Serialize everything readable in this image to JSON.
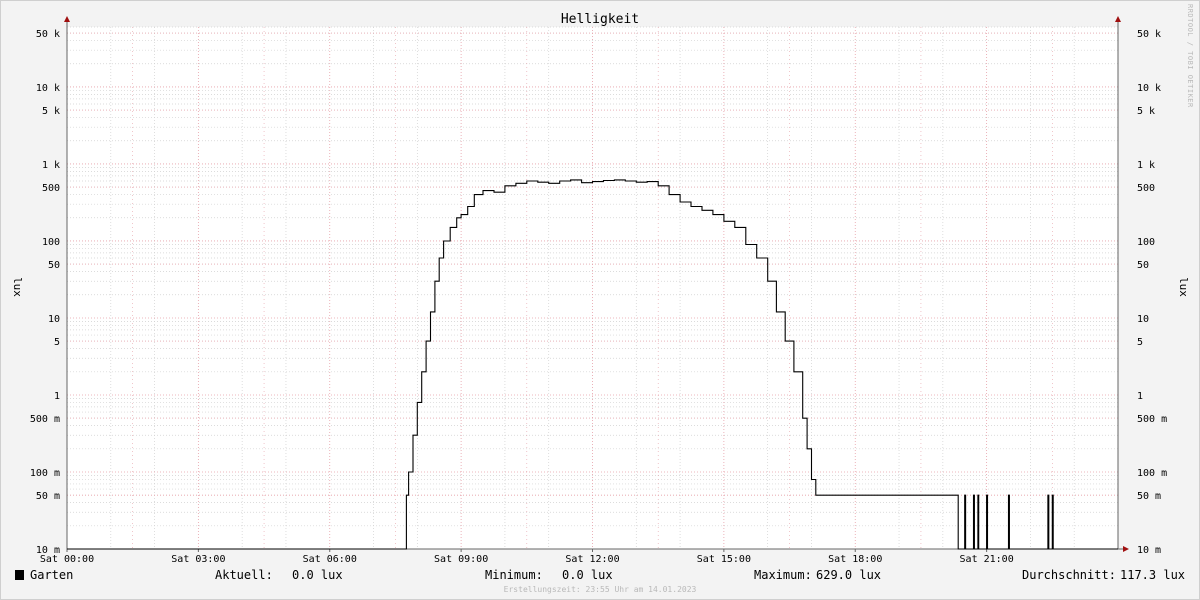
{
  "chart_data": {
    "type": "line",
    "title": "Helligkeit",
    "ylabel": "lux",
    "y_scale": "log",
    "ylim": [
      0.01,
      60000
    ],
    "xlim": [
      0,
      24
    ],
    "grid": true,
    "y_ticks": [
      {
        "value": 0.01,
        "label": "10 m"
      },
      {
        "value": 0.05,
        "label": "50 m"
      },
      {
        "value": 0.1,
        "label": "100 m"
      },
      {
        "value": 0.5,
        "label": "500 m"
      },
      {
        "value": 1,
        "label": "1"
      },
      {
        "value": 5,
        "label": "5"
      },
      {
        "value": 10,
        "label": "10"
      },
      {
        "value": 50,
        "label": "50"
      },
      {
        "value": 100,
        "label": "100"
      },
      {
        "value": 500,
        "label": "500"
      },
      {
        "value": 1000,
        "label": "1 k"
      },
      {
        "value": 5000,
        "label": "5 k"
      },
      {
        "value": 10000,
        "label": "10 k"
      },
      {
        "value": 50000,
        "label": "50 k"
      }
    ],
    "x_ticks": [
      {
        "value": 0,
        "label": "Sat 00:00"
      },
      {
        "value": 3,
        "label": "Sat 03:00"
      },
      {
        "value": 6,
        "label": "Sat 06:00"
      },
      {
        "value": 9,
        "label": "Sat 09:00"
      },
      {
        "value": 12,
        "label": "Sat 12:00"
      },
      {
        "value": 15,
        "label": "Sat 15:00"
      },
      {
        "value": 18,
        "label": "Sat 18:00"
      },
      {
        "value": 21,
        "label": "Sat 21:00"
      }
    ],
    "series": [
      {
        "name": "Garten",
        "color": "#000000",
        "x": [
          0,
          7.75,
          7.8,
          7.9,
          8.0,
          8.1,
          8.2,
          8.3,
          8.4,
          8.5,
          8.6,
          8.75,
          8.9,
          9.0,
          9.15,
          9.3,
          9.5,
          9.75,
          10.0,
          10.25,
          10.5,
          10.75,
          11.0,
          11.25,
          11.5,
          11.75,
          12.0,
          12.25,
          12.5,
          12.75,
          13.0,
          13.25,
          13.5,
          13.75,
          14.0,
          14.25,
          14.5,
          14.75,
          15.0,
          15.25,
          15.5,
          15.75,
          16.0,
          16.2,
          16.4,
          16.6,
          16.8,
          16.9,
          17.0,
          17.1,
          17.2,
          17.3,
          17.4,
          17.45,
          17.5,
          17.55,
          19.0,
          19.25,
          20.3,
          20.35,
          20.5,
          20.52,
          20.7,
          20.72,
          20.8,
          20.82,
          21.0,
          21.02,
          21.5,
          21.52,
          22.4,
          22.42,
          22.5,
          22.52,
          24.0
        ],
        "y": [
          0.01,
          0.05,
          0.1,
          0.3,
          0.8,
          2,
          5,
          12,
          30,
          60,
          100,
          150,
          200,
          220,
          280,
          400,
          450,
          430,
          520,
          560,
          600,
          580,
          560,
          600,
          620,
          570,
          590,
          610,
          620,
          600,
          580,
          590,
          520,
          400,
          320,
          280,
          250,
          220,
          180,
          150,
          90,
          60,
          30,
          12,
          5,
          2,
          0.5,
          0.2,
          0.08,
          0.05,
          0.05,
          0.05,
          0.05,
          0.05,
          0.05,
          0.05,
          0.05,
          0.05,
          0.05,
          0.01,
          0.05,
          0.01,
          0.05,
          0.01,
          0.05,
          0.01,
          0.05,
          0.01,
          0.05,
          0.01,
          0.05,
          0.01,
          0.05,
          0.01,
          0.01
        ]
      }
    ]
  },
  "legend": {
    "series_name": "Garten",
    "current_label": "Aktuell:",
    "current_value": "0.0 lux",
    "min_label": "Minimum:",
    "min_value": "0.0 lux",
    "max_label": "Maximum:",
    "max_value": "629.0 lux",
    "avg_label": "Durchschnitt:",
    "avg_value": "117.3 lux"
  },
  "footer": "Erstellungszeit: 23:55 Uhr am 14.01.2023",
  "watermark": "RRDTOOL / TOBI OETIKER",
  "colors": {
    "background": "#f3f3f3",
    "canvas": "#ffffff",
    "major_grid": "#e6a0a8",
    "minor_grid": "#d0d0d0",
    "axis": "#666666",
    "arrow": "#a01010",
    "line": "#000000"
  }
}
